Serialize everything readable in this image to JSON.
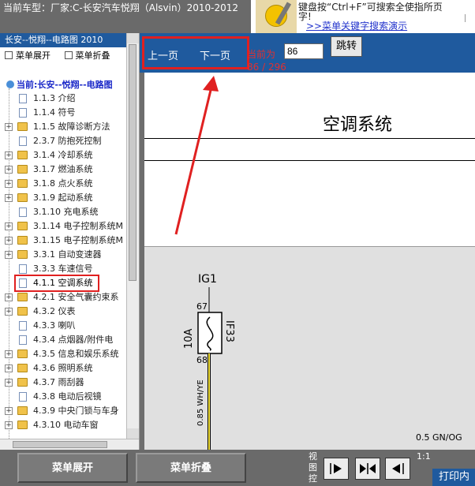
{
  "top_bar": {
    "car_info": "当前车型：厂家:C-长安汽车悦翔（Alsvin）2010-2012"
  },
  "promo": {
    "line1": "键盘按“Ctrl+F”可搜索全使指所页",
    "line2": "字!",
    "link": ">>菜单关键字搜索演示"
  },
  "sidebar": {
    "title": "长安--悦翔--电路图 2010",
    "expand_all": "菜单展开",
    "collapse_all": "菜单折叠",
    "current_root": "当前:长安--悦翔--电路图",
    "items": [
      {
        "label": "1.1.3 介绍",
        "type": "page",
        "expander": ""
      },
      {
        "label": "1.1.4 符号",
        "type": "page",
        "expander": ""
      },
      {
        "label": "1.1.5 故障诊断方法",
        "type": "folder",
        "expander": "+"
      },
      {
        "label": "2.3.7 防抱死控制",
        "type": "page",
        "expander": ""
      },
      {
        "label": "3.1.4 冷却系统",
        "type": "folder",
        "expander": "+"
      },
      {
        "label": "3.1.7 燃油系统",
        "type": "folder",
        "expander": "+"
      },
      {
        "label": "3.1.8 点火系统",
        "type": "folder",
        "expander": "+"
      },
      {
        "label": "3.1.9 起动系统",
        "type": "folder",
        "expander": "+"
      },
      {
        "label": "3.1.10 充电系统",
        "type": "page",
        "expander": ""
      },
      {
        "label": "3.1.14 电子控制系统M",
        "type": "folder",
        "expander": "+"
      },
      {
        "label": "3.1.15 电子控制系统M",
        "type": "folder",
        "expander": "+"
      },
      {
        "label": "3.3.1 自动变速器",
        "type": "folder",
        "expander": "+"
      },
      {
        "label": "3.3.3 车速信号",
        "type": "page",
        "expander": ""
      },
      {
        "label": "4.1.1 空调系统",
        "type": "page",
        "expander": ""
      },
      {
        "label": "4.2.1 安全气囊约束系",
        "type": "folder",
        "expander": "+"
      },
      {
        "label": "4.3.2 仪表",
        "type": "folder",
        "expander": "+"
      },
      {
        "label": "4.3.3 喇叭",
        "type": "page",
        "expander": ""
      },
      {
        "label": "4.3.4 点烟器/附件电",
        "type": "page",
        "expander": ""
      },
      {
        "label": "4.3.5 信息和娱乐系统",
        "type": "folder",
        "expander": "+"
      },
      {
        "label": "4.3.6 照明系统",
        "type": "folder",
        "expander": "+"
      },
      {
        "label": "4.3.7 雨刮器",
        "type": "folder",
        "expander": "+"
      },
      {
        "label": "4.3.8 电动后视镜",
        "type": "page",
        "expander": ""
      },
      {
        "label": "4.3.9 中央门锁与车身",
        "type": "folder",
        "expander": "+"
      },
      {
        "label": "4.3.10 电动车窗",
        "type": "folder",
        "expander": "+"
      }
    ]
  },
  "nav": {
    "prev_label": "上一页",
    "next_label": "下一页",
    "current_label": "当前为",
    "page_value": "86",
    "page_of": "86 / 296",
    "go_label": "跳转"
  },
  "document": {
    "title": "空调系统",
    "diagram": {
      "ig": "IG1",
      "pin_top": "67",
      "pin_bottom": "68",
      "amp": "10A",
      "fuse": "IF33",
      "wire": "0.85 WH/YE",
      "bottom_right": "0.5 GN/OG"
    }
  },
  "bottom": {
    "expand_btn": "菜单展开",
    "collapse_btn": "菜单折叠",
    "view_ctrl_label": "视图控",
    "zoom": "1:1",
    "print": "打印内"
  },
  "colors": {
    "accent": "#1f5a9e",
    "highlight": "#e02020"
  }
}
